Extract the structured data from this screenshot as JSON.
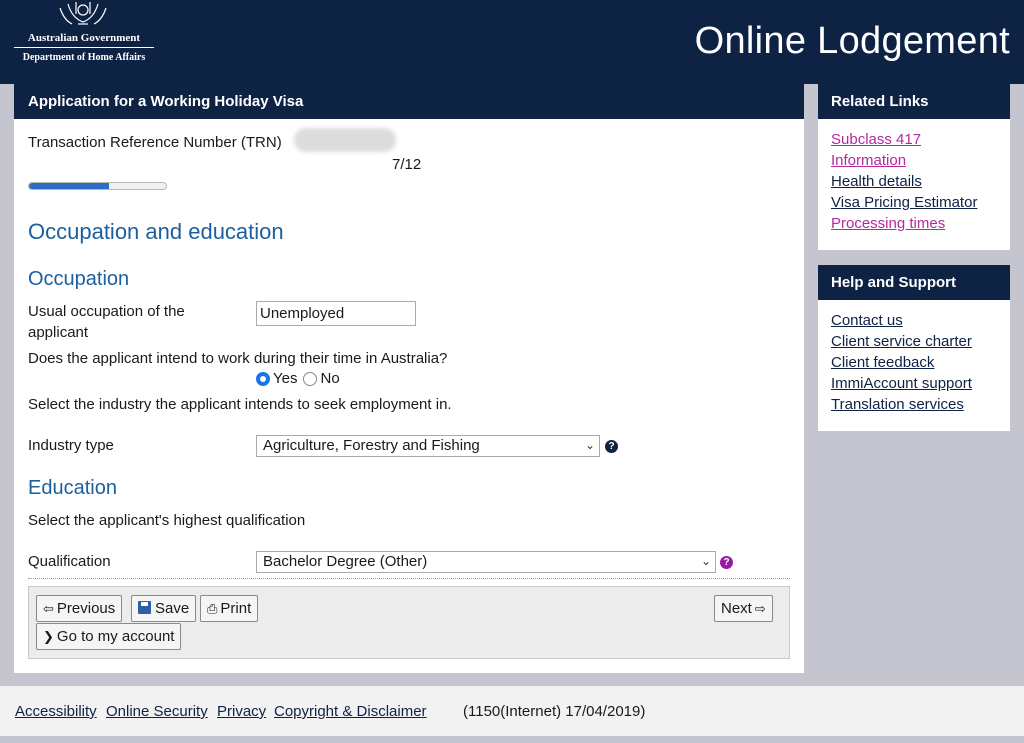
{
  "header": {
    "gov_line1": "Australian Government",
    "gov_line2": "Department of Home Affairs",
    "site_title": "Online Lodgement"
  },
  "application": {
    "title": "Application for a Working Holiday Visa",
    "trn_label": "Transaction Reference Number (TRN)",
    "page_progress": "7/12",
    "progress_fraction": 0.583,
    "page_heading": "Occupation and education"
  },
  "occupation": {
    "heading": "Occupation",
    "usual_label": "Usual occupation of the applicant",
    "usual_value": "Unemployed",
    "work_question": "Does the applicant intend to work during their time in Australia?",
    "yes_label": "Yes",
    "no_label": "No",
    "work_answer": "Yes",
    "industry_prompt": "Select the industry the applicant intends to seek employment in.",
    "industry_label": "Industry type",
    "industry_value": "Agriculture, Forestry and Fishing"
  },
  "education": {
    "heading": "Education",
    "prompt": "Select the applicant's highest qualification",
    "qualification_label": "Qualification",
    "qualification_value": "Bachelor Degree (Other)"
  },
  "buttons": {
    "previous": "Previous",
    "save": "Save",
    "print": "Print",
    "next": "Next",
    "account": "Go to my account"
  },
  "related_links": {
    "title": "Related Links",
    "items": [
      {
        "label": "Subclass 417 Information",
        "visited": true
      },
      {
        "label": "Health details",
        "visited": false
      },
      {
        "label": "Visa Pricing Estimator",
        "visited": false
      },
      {
        "label": "Processing times",
        "visited": true
      }
    ]
  },
  "help_support": {
    "title": "Help and Support",
    "items": [
      {
        "label": "Contact us"
      },
      {
        "label": "Client service charter"
      },
      {
        "label": "Client feedback"
      },
      {
        "label": "ImmiAccount support"
      },
      {
        "label": "Translation services"
      }
    ]
  },
  "footer": {
    "accessibility": "Accessibility",
    "security": "Online Security",
    "privacy": "Privacy",
    "copyright": "Copyright & Disclaimer",
    "version": "(1150(Internet) 17/04/2019)"
  },
  "colors": {
    "navy": "#0e2244",
    "heading_blue": "#1c5f9f",
    "visited_link": "#b5289e",
    "background": "#c4c5cf"
  }
}
